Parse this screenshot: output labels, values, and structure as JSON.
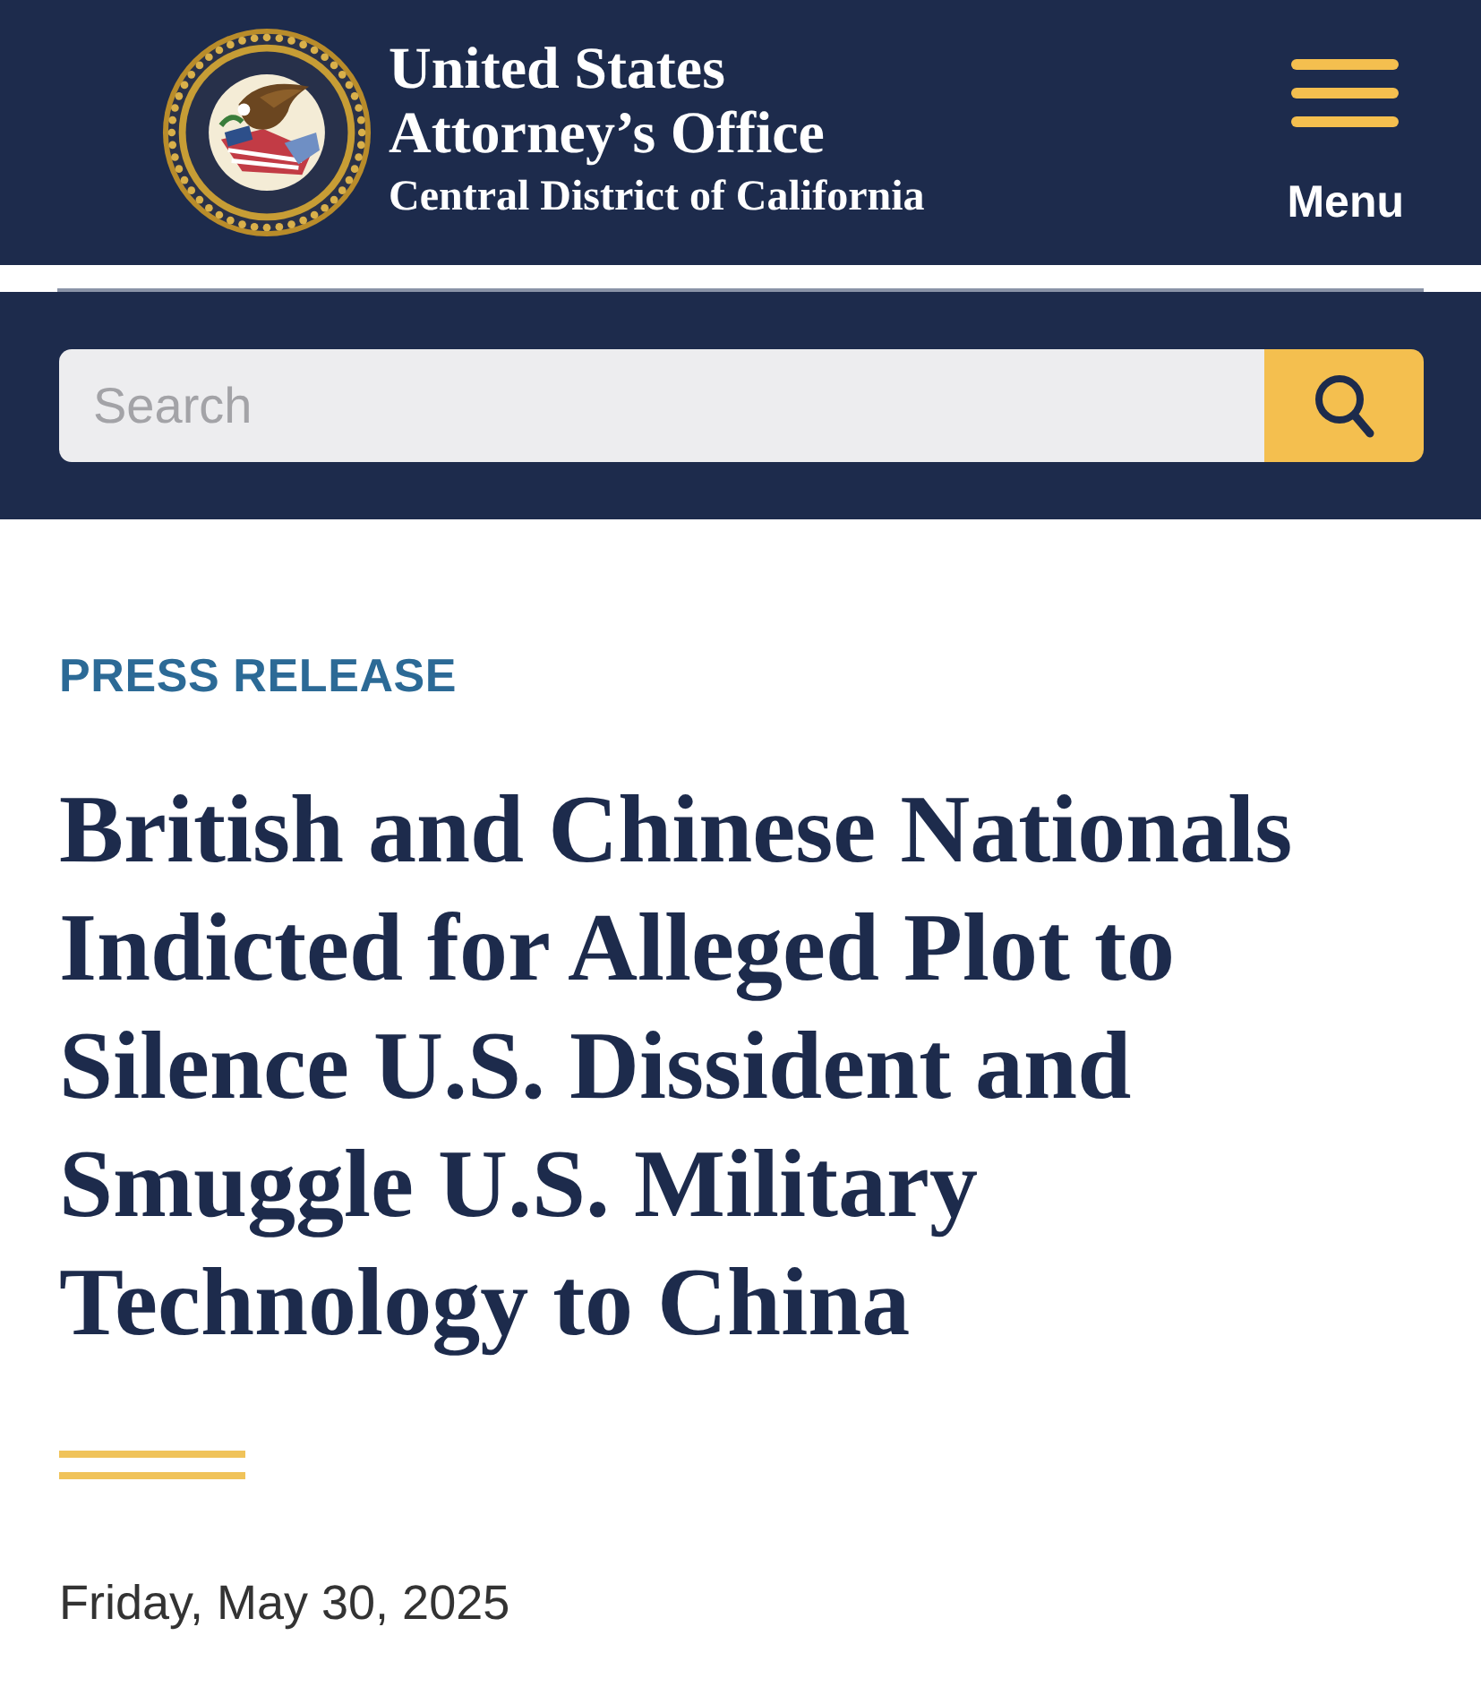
{
  "header": {
    "title_lines": [
      "United States",
      "Attorney’s Office"
    ],
    "subtitle": "Central District of California",
    "menu_button": {
      "label": "Menu"
    }
  },
  "search": {
    "placeholder": "Search"
  },
  "article": {
    "category": "PRESS RELEASE",
    "title": "British and Chinese Nationals Indicted for Alleged Plot to Silence U.S. Dissident and Smuggle U.S. Military Technology to China",
    "date": "Friday, May 30, 2025"
  }
}
